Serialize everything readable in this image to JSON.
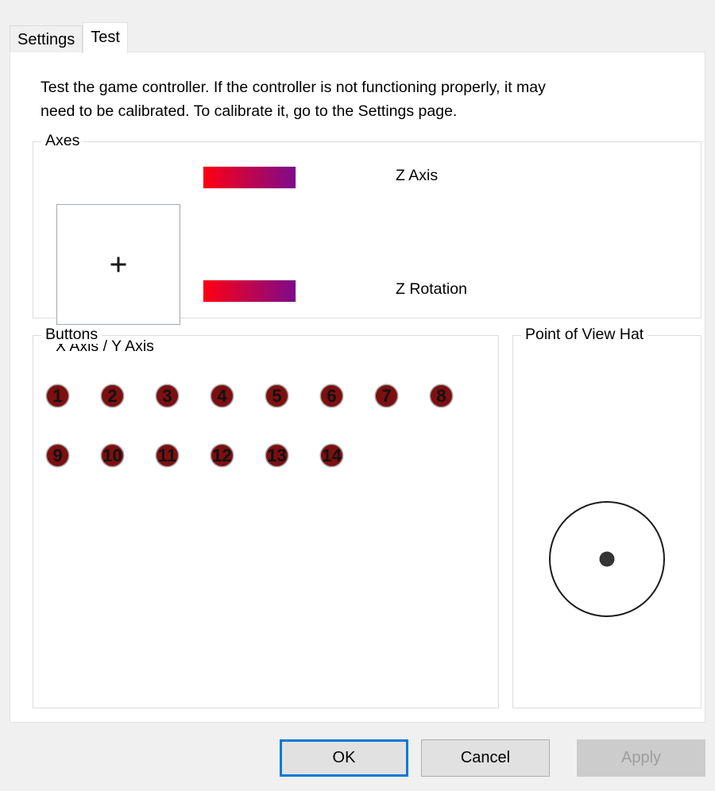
{
  "dialog": {
    "tabs": [
      {
        "id": "settings",
        "label": "Settings",
        "active": false
      },
      {
        "id": "test",
        "label": "Test",
        "active": true
      }
    ],
    "description": "Test the game controller.  If the controller is not functioning properly, it may\nneed to be calibrated.  To calibrate it, go to the Settings page."
  },
  "axes": {
    "group_label": "Axes",
    "xy_label": "X Axis / Y Axis",
    "crosshair_icon": "crosshair-icon",
    "bars": [
      {
        "id": "z-axis",
        "label": "Z Axis",
        "gradient_start": "#FF0010",
        "gradient_end": "#7D0B8C",
        "fill_percent": 100
      },
      {
        "id": "z-rotation",
        "label": "Z Rotation",
        "gradient_start": "#FF0010",
        "gradient_end": "#7D0B8C",
        "fill_percent": 100
      }
    ]
  },
  "buttons_group": {
    "group_label": "Buttons",
    "button_color": "#7D0F10",
    "button_border_color": "#A6A6A6",
    "rows": [
      {
        "labels": [
          "1",
          "2",
          "3",
          "4",
          "5",
          "6",
          "7",
          "8"
        ]
      },
      {
        "labels": [
          "9",
          "10",
          "11",
          "12",
          "13",
          "14"
        ]
      }
    ]
  },
  "pov": {
    "group_label": "Point of View Hat",
    "circle_icon": "pov-circle-icon",
    "center_dot_icon": "pov-center-dot-icon",
    "center_dot_color": "#3C3C3C"
  },
  "footer": {
    "ok_label": "OK",
    "cancel_label": "Cancel",
    "apply_label": "Apply",
    "apply_enabled": false,
    "default_button": "OK",
    "focus_color": "#0078D7"
  }
}
